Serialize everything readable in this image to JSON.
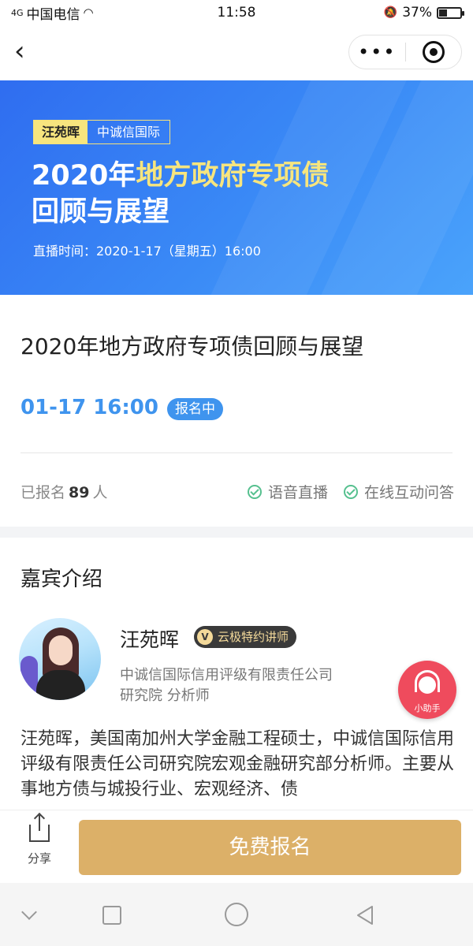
{
  "status_bar": {
    "network": "4G",
    "carrier": "中国电信",
    "time": "11:58",
    "battery": "37%",
    "battery_level": 0.37
  },
  "nav": {
    "back_icon": "chevron-left-icon",
    "more_icon": "more-dots-icon",
    "target_icon": "target-icon"
  },
  "banner": {
    "speaker_tag": "汪苑晖",
    "org_tag": "中诚信国际",
    "title_part1": "2020年",
    "title_highlight": "地方政府专项债",
    "title_line2": "回顾与展望",
    "live_time": "直播时间：2020-1-17（星期五）16:00",
    "highlight_color": "#f7e57e",
    "bg_color": "#2f6df0"
  },
  "event": {
    "title": "2020年地方政府专项债回顾与展望",
    "datetime": "01-17 16:00",
    "status": "报名中",
    "enrolled_prefix": "已报名",
    "enrolled_count": "89",
    "enrolled_suffix": "人",
    "features": [
      "语音直播",
      "在线互动问答"
    ],
    "accent_color": "#3f94ee"
  },
  "guest": {
    "section_title": "嘉宾介绍",
    "name": "汪苑晖",
    "badge": "云极特约讲师",
    "badge_icon": "V",
    "org": "中诚信国际信用评级有限责任公司",
    "role": "研究院 分析师",
    "bio": "汪苑晖，美国南加州大学金融工程硕士，中诚信国际信用评级有限责任公司研究院宏观金融研究部分析师。主要从事地方债与城投行业、宏观经济、债"
  },
  "helper": {
    "label": "小助手"
  },
  "bottom_bar": {
    "share_label": "分享",
    "register_label": "免费报名",
    "button_color": "#dcb068"
  }
}
